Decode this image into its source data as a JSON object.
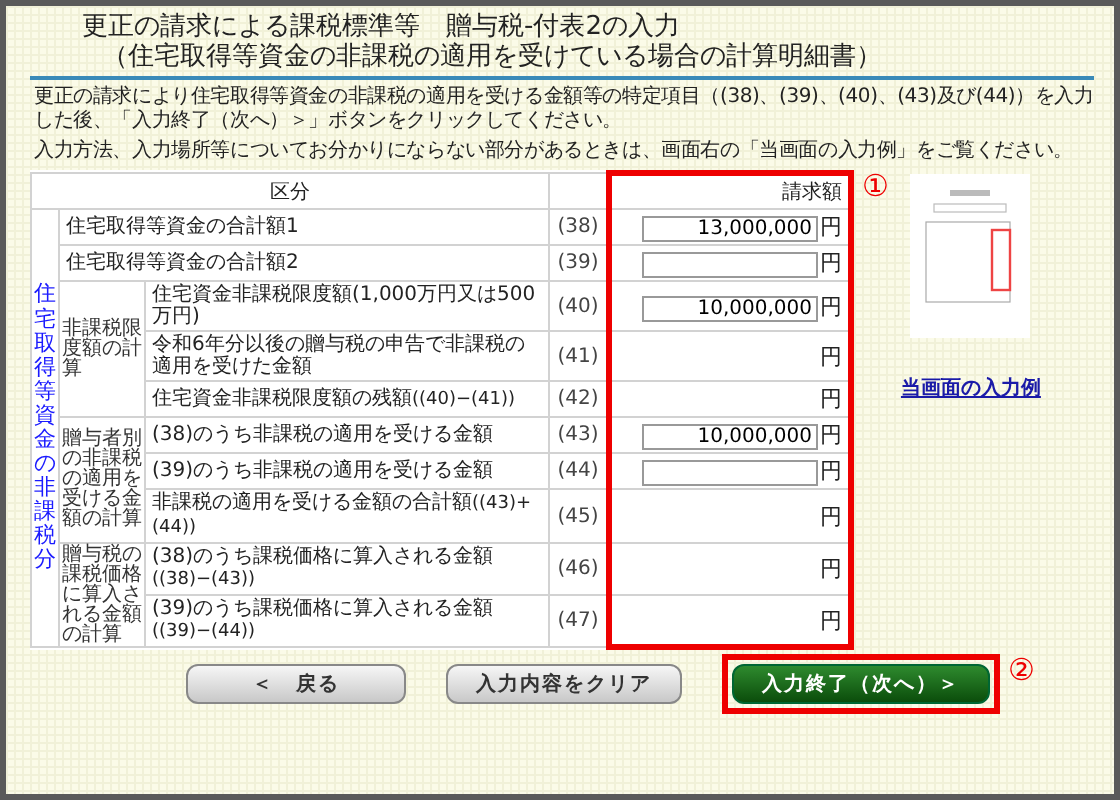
{
  "title": [
    "更正の請求による課税標準等　贈与税-付表2の入力",
    "（住宅取得等資金の非課税の適用を受けている場合の計算明細書）"
  ],
  "instructions": [
    "更正の請求により住宅取得等資金の非課税の適用を受ける金額等の特定項目（(38)、(39)、(40)、(43)及び(44)）を入力した後、「入力終了（次へ）＞」ボタンをクリックしてください。",
    "入力方法、入力場所等についてお分かりにならない部分があるときは、画面右の「当画面の入力例」をご覧ください。"
  ],
  "table": {
    "columns": [
      "区分",
      "請求額"
    ],
    "marker": "①",
    "group_label": "住宅取得等資金の非課税分",
    "items": [
      {
        "kind": "input",
        "label": "住宅取得等資金の合計額1",
        "ref": "(38)",
        "value": "13,000,000",
        "unit": "円"
      },
      {
        "kind": "input",
        "label": "住宅取得等資金の合計額2",
        "ref": "(39)",
        "unit": "円"
      },
      {
        "kind": "group",
        "label": "非課税限度額の計算",
        "rows": [
          {
            "kind": "input",
            "label": "住宅資金非課税限度額(1,000万円又は500万円)",
            "ref": "(40)",
            "value": "10,000,000",
            "unit": "円"
          },
          {
            "kind": "readout",
            "label": "令和6年分以後の贈与税の申告で非課税の適用を受けた金額",
            "ref": "(41)",
            "unit": "円"
          },
          {
            "kind": "readout",
            "label": "住宅資金非課税限度額の残額",
            "formula": "((40)−(41))",
            "ref": "(42)",
            "unit": "円"
          }
        ]
      },
      {
        "kind": "group",
        "label": "贈与者別の非課税の適用を受ける金額の計算",
        "rows": [
          {
            "kind": "input",
            "label": "(38)のうち非課税の適用を受ける金額",
            "ref": "(43)",
            "value": "10,000,000",
            "unit": "円"
          },
          {
            "kind": "input",
            "label": "(39)のうち非課税の適用を受ける金額",
            "ref": "(44)",
            "unit": "円"
          },
          {
            "kind": "readout",
            "label": "非課税の適用を受ける金額の合計額",
            "formula": "((43)+(44))",
            "ref": "(45)",
            "unit": "円"
          }
        ]
      },
      {
        "kind": "group",
        "label": "贈与税の課税価格に算入される金額の計算",
        "rows": [
          {
            "kind": "readout",
            "label": "(38)のうち課税価格に算入される金額",
            "formula": "((38)−(43))",
            "ref": "(46)",
            "unit": "円"
          },
          {
            "kind": "readout",
            "label": "(39)のうち課税価格に算入される金額",
            "formula": "((39)−(44))",
            "ref": "(47)",
            "unit": "円"
          }
        ]
      }
    ]
  },
  "example_link": "当画面の入力例",
  "buttons": [
    {
      "kind": "back",
      "label": "＜　戻る"
    },
    {
      "kind": "clear",
      "label": "入力内容をクリア"
    },
    {
      "kind": "next",
      "label": "入力終了（次へ）＞",
      "marker": "②"
    }
  ]
}
